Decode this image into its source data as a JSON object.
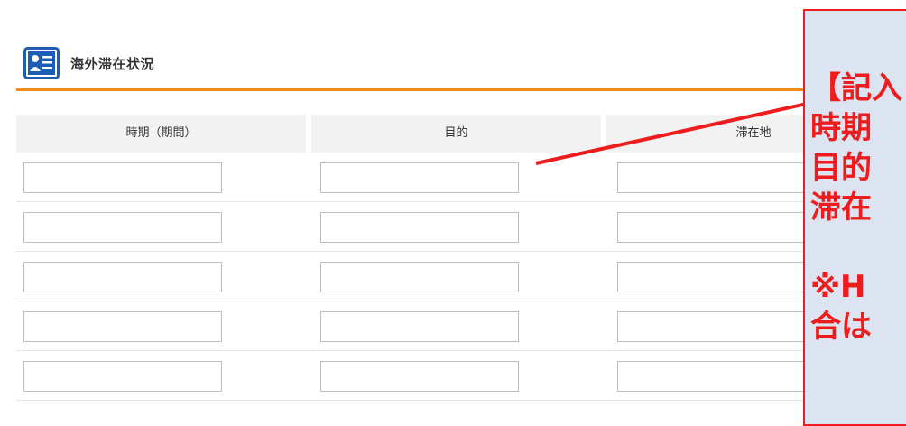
{
  "section": {
    "title": "海外滞在状況",
    "icon": "profile-card-icon"
  },
  "table": {
    "headers": [
      "時期（期間）",
      "目的",
      "滞在地"
    ],
    "rows": 5,
    "values": [
      [
        "",
        "",
        ""
      ],
      [
        "",
        "",
        ""
      ],
      [
        "",
        "",
        ""
      ],
      [
        "",
        "",
        ""
      ],
      [
        "",
        "",
        ""
      ]
    ]
  },
  "callout": {
    "line1": "【記入",
    "line2": "時期",
    "line3": "目的",
    "line4": "滞在",
    "line5": "※H",
    "line6": "合は",
    "border_color": "#ee1c1c",
    "background_color": "#dce4f2"
  },
  "colors": {
    "accent_rule": "#ef8c1a",
    "header_bg": "#f2f2f2",
    "icon_blue": "#1c5db5"
  }
}
